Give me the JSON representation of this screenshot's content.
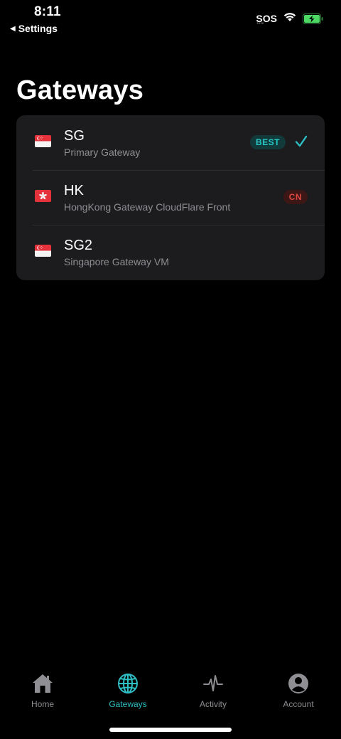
{
  "status_bar": {
    "time": "8:11",
    "back_label": "Settings",
    "sos": "SOS"
  },
  "page": {
    "title": "Gateways"
  },
  "gateways": [
    {
      "flag": "singapore-flag",
      "name": "SG",
      "subtitle": "Primary Gateway",
      "badge": "BEST",
      "selected": true
    },
    {
      "flag": "hong-kong-flag",
      "name": "HK",
      "subtitle": "HongKong Gateway CloudFlare Front",
      "badge": "CN",
      "selected": false
    },
    {
      "flag": "singapore-flag",
      "name": "SG2",
      "subtitle": "Singapore Gateway VM",
      "badge": "",
      "selected": false
    }
  ],
  "tabbar": {
    "items": [
      {
        "label": "Home",
        "icon": "home-icon"
      },
      {
        "label": "Gateways",
        "icon": "globe-icon",
        "active": true
      },
      {
        "label": "Activity",
        "icon": "pulse-icon"
      },
      {
        "label": "Account",
        "icon": "person-circle-icon"
      }
    ]
  },
  "colors": {
    "accent": "#2dbfc4",
    "best_bg": "#123a3a",
    "cn_text": "#e0483e",
    "cn_bg": "#3d1616",
    "card_bg": "#1c1c1e"
  }
}
